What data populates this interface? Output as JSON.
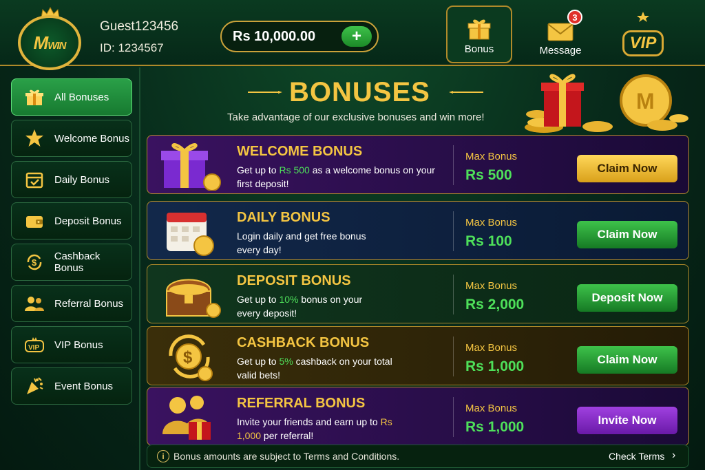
{
  "header": {
    "logo_text_m": "M",
    "logo_text_win": "WIN",
    "username": "Guest123456",
    "user_id": "ID: 1234567",
    "balance": "Rs 10,000.00",
    "add_symbol": "+",
    "nav": [
      {
        "label": "Bonus",
        "icon": "gift-icon",
        "active": true
      },
      {
        "label": "Message",
        "icon": "envelope-icon",
        "badge": "3"
      },
      {
        "label": "VIP",
        "icon": "vip-crown-icon"
      }
    ]
  },
  "sidebar": {
    "items": [
      {
        "label": "All Bonuses",
        "icon": "gift-icon",
        "active": true
      },
      {
        "label": "Welcome Bonus",
        "icon": "star-icon"
      },
      {
        "label": "Daily Bonus",
        "icon": "calendar-check-icon"
      },
      {
        "label": "Deposit Bonus",
        "icon": "wallet-icon"
      },
      {
        "label": "Cashback Bonus",
        "icon": "cashback-icon"
      },
      {
        "label": "Referral Bonus",
        "icon": "users-icon"
      },
      {
        "label": "VIP Bonus",
        "icon": "vip-icon"
      },
      {
        "label": "Event Bonus",
        "icon": "party-popper-icon"
      }
    ]
  },
  "banner": {
    "title": "BONUSES",
    "subtitle": "Take advantage of our exclusive bonuses and win more!"
  },
  "bonuses": [
    {
      "title": "WELCOME BONUS",
      "desc_pre": "Get up to ",
      "desc_hl": "Rs 500",
      "desc_post": " as a welcome bonus on your first deposit!",
      "max_label": "Max Bonus",
      "max_value": "Rs 500",
      "cta": "Claim Now",
      "cta_style": "gold",
      "bg": "#2a0f4a"
    },
    {
      "title": "DAILY BONUS",
      "desc_pre": "Login daily and get free bonus every day!",
      "desc_hl": "",
      "desc_post": "",
      "max_label": "Max Bonus",
      "max_value": "Rs 100",
      "cta": "Claim Now",
      "cta_style": "green",
      "bg": "#0e2040"
    },
    {
      "title": "DEPOSIT BONUS",
      "desc_pre": "Get up to ",
      "desc_hl": "10%",
      "desc_post": " bonus on your every deposit!",
      "max_label": "Max Bonus",
      "max_value": "Rs 2,000",
      "cta": "Deposit Now",
      "cta_style": "green",
      "bg": "#0c2a1a"
    },
    {
      "title": "CASHBACK BONUS",
      "desc_pre": "Get up to ",
      "desc_hl": "5%",
      "desc_post": " cashback on your total valid bets!",
      "max_label": "Max Bonus",
      "max_value": "Rs 1,000",
      "cta": "Claim Now",
      "cta_style": "green",
      "bg": "#2a2208"
    },
    {
      "title": "REFERRAL BONUS",
      "desc_pre": "Invite your friends and earn up to ",
      "desc_hl": "Rs 1,000",
      "desc_post": " per referral!",
      "max_label": "Max Bonus",
      "max_value": "Rs 1,000",
      "cta": "Invite Now",
      "cta_style": "purple",
      "bg": "#2a0f4a"
    }
  ],
  "footer": {
    "info_symbol": "i",
    "note": "Bonus amounts are subject to Terms and Conditions.",
    "link": "Check Terms",
    "chevron": "›"
  },
  "colors": {
    "accent_gold": "#f4c542",
    "accent_green": "#4ee05a",
    "bg_dark_green": "#062616"
  }
}
